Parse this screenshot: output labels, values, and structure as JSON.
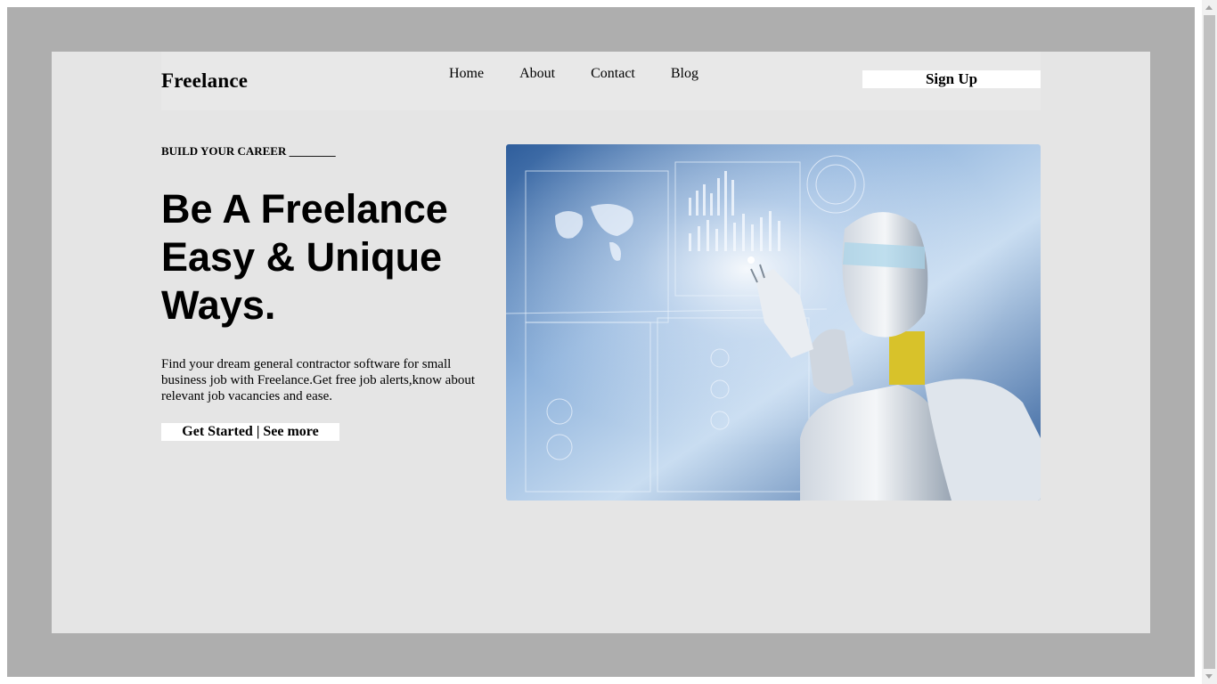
{
  "navbar": {
    "logo": "Freelance",
    "links": [
      "Home",
      "About",
      "Contact",
      "Blog"
    ],
    "signup_label": "Sign Up"
  },
  "hero": {
    "eyebrow": "BUILD YOUR CAREER ________",
    "headline": [
      "Be A Freelance",
      "Easy & Unique",
      "Ways."
    ],
    "description": "Find your dream general contractor software for small business job with Freelance.Get free job alerts,know about relevant job vacancies and ease.",
    "cta_label": "Get Started | See more",
    "image_icon": "robot-touching-hologram-image"
  },
  "colors": {
    "outer_background": "#aeaeae",
    "card_background": "#e5e5e5",
    "button_background": "#ffffff",
    "text": "#000000"
  }
}
